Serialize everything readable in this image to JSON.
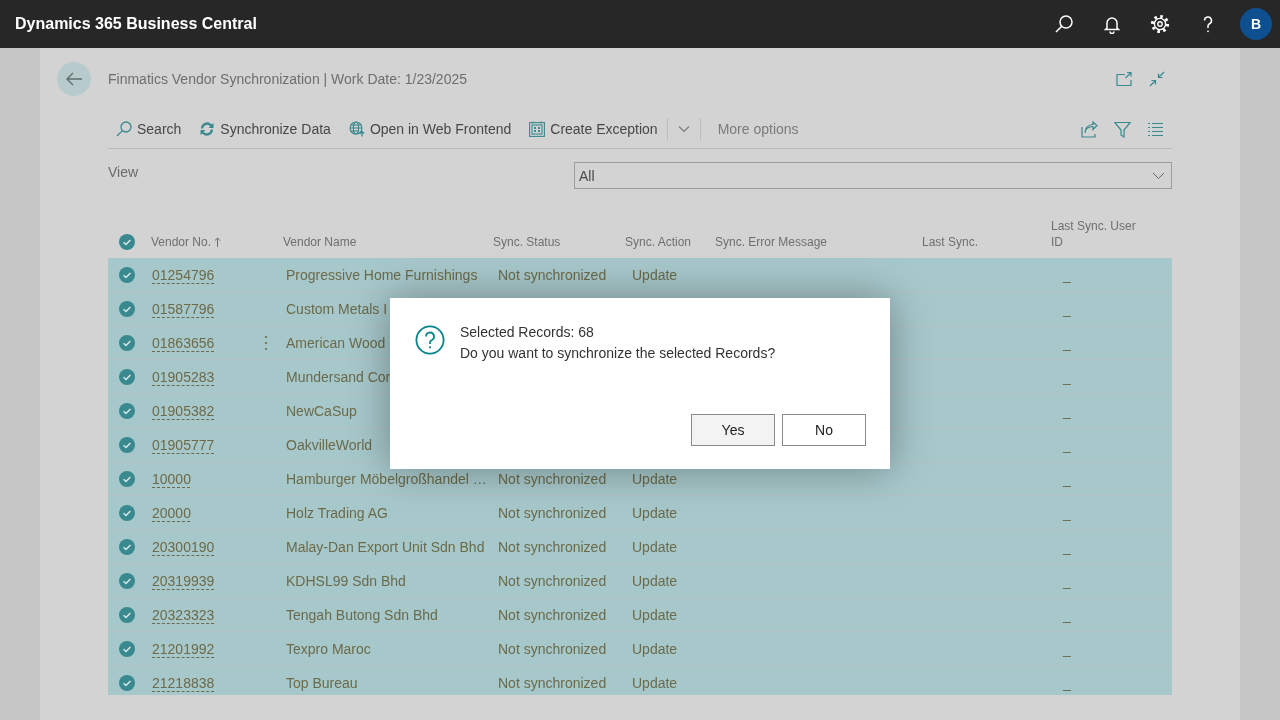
{
  "app_bar": {
    "title": "Dynamics 365 Business Central",
    "avatar": "B"
  },
  "page": {
    "title": "Finmatics Vendor Synchronization | Work Date: 1/23/2025"
  },
  "actions": [
    {
      "kind": "search",
      "label": "Search"
    },
    {
      "kind": "sync",
      "label": "Synchronize Data"
    },
    {
      "kind": "web",
      "label": "Open in Web Frontend"
    },
    {
      "kind": "exception",
      "label": "Create Exception"
    }
  ],
  "more_options": "More options",
  "view": {
    "label": "View",
    "value": "All"
  },
  "table": {
    "all_selected": true,
    "columns": [
      {
        "label": "Vendor No.",
        "sorted": true
      },
      {
        "label": "Vendor Name",
        "sorted": false
      },
      {
        "label": "Sync. Status",
        "sorted": false
      },
      {
        "label": "Sync. Action",
        "sorted": false
      },
      {
        "label": "Sync. Error Message",
        "sorted": false
      },
      {
        "label": "Last Sync.",
        "sorted": false
      },
      {
        "label": "Last Sync. User ID",
        "sorted": false
      }
    ],
    "rows": [
      {
        "selected": true,
        "focused": false,
        "vendor_no": "01254796",
        "vendor_name": "Progressive Home Furnishings",
        "sync_status": "Not synchronized",
        "sync_action": "Update",
        "last_sync_user_id": "_"
      },
      {
        "selected": true,
        "focused": false,
        "vendor_no": "01587796",
        "vendor_name": "Custom Metals I",
        "last_sync_user_id": "_"
      },
      {
        "selected": true,
        "focused": true,
        "vendor_no": "01863656",
        "vendor_name": "American Wood",
        "last_sync_user_id": "_"
      },
      {
        "selected": true,
        "focused": false,
        "vendor_no": "01905283",
        "vendor_name": "Mundersand Cor",
        "last_sync_user_id": "_"
      },
      {
        "selected": true,
        "focused": false,
        "vendor_no": "01905382",
        "vendor_name": "NewCaSup",
        "last_sync_user_id": "_"
      },
      {
        "selected": true,
        "focused": false,
        "vendor_no": "01905777",
        "vendor_name": "OakvilleWorld",
        "last_sync_user_id": "_"
      },
      {
        "selected": true,
        "focused": false,
        "vendor_no": "10000",
        "vendor_name": "Hamburger Möbelgroßhandel …",
        "sync_status": "Not synchronized",
        "sync_action": "Update",
        "last_sync_user_id": "_"
      },
      {
        "selected": true,
        "focused": false,
        "vendor_no": "20000",
        "vendor_name": "Holz Trading AG",
        "sync_status": "Not synchronized",
        "sync_action": "Update",
        "last_sync_user_id": "_"
      },
      {
        "selected": true,
        "focused": false,
        "vendor_no": "20300190",
        "vendor_name": "Malay-Dan Export Unit Sdn Bhd",
        "sync_status": "Not synchronized",
        "sync_action": "Update",
        "last_sync_user_id": "_"
      },
      {
        "selected": true,
        "focused": false,
        "vendor_no": "20319939",
        "vendor_name": "KDHSL99 Sdn Bhd",
        "sync_status": "Not synchronized",
        "sync_action": "Update",
        "last_sync_user_id": "_"
      },
      {
        "selected": true,
        "focused": false,
        "vendor_no": "20323323",
        "vendor_name": "Tengah Butong Sdn Bhd",
        "sync_status": "Not synchronized",
        "sync_action": "Update",
        "last_sync_user_id": "_"
      },
      {
        "selected": true,
        "focused": false,
        "vendor_no": "21201992",
        "vendor_name": "Texpro Maroc",
        "sync_status": "Not synchronized",
        "sync_action": "Update",
        "last_sync_user_id": "_"
      },
      {
        "selected": true,
        "focused": false,
        "vendor_no": "21218838",
        "vendor_name": "Top Bureau",
        "sync_status": "Not synchronized",
        "sync_action": "Update",
        "last_sync_user_id": "_"
      }
    ]
  },
  "dialog": {
    "lines": [
      "Selected Records: 68",
      "Do you want to synchronize the selected Records?"
    ],
    "buttons": [
      {
        "label": "Yes",
        "default": true
      },
      {
        "label": "No",
        "default": false
      }
    ]
  }
}
